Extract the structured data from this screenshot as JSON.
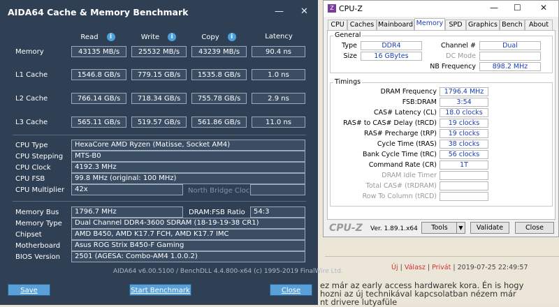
{
  "forum": {
    "meta_reply": "Új",
    "meta_quote": "Válasz",
    "meta_private": "Privát",
    "meta_date": "2019-07-25 22:49:57",
    "text_line1": "ez már az early access hardwarek kora. Én is hogy",
    "text_line2": "hozni az új technikával kapcsolatban nézem már",
    "text_line3": "nt drivere lutyafüle"
  },
  "aida": {
    "title": "AIDA64 Cache & Memory Benchmark",
    "minimize": "—",
    "close": "✕",
    "columns": {
      "read": "Read",
      "write": "Write",
      "copy": "Copy",
      "latency": "Latency"
    },
    "rows": [
      {
        "label": "Memory",
        "read": "43135 MB/s",
        "write": "25532 MB/s",
        "copy": "43239 MB/s",
        "latency": "90.4 ns"
      },
      {
        "label": "L1 Cache",
        "read": "1546.8 GB/s",
        "write": "779.15 GB/s",
        "copy": "1535.8 GB/s",
        "latency": "1.0 ns"
      },
      {
        "label": "L2 Cache",
        "read": "766.14 GB/s",
        "write": "718.34 GB/s",
        "copy": "755.78 GB/s",
        "latency": "2.9 ns"
      },
      {
        "label": "L3 Cache",
        "read": "565.11 GB/s",
        "write": "519.57 GB/s",
        "copy": "561.86 GB/s",
        "latency": "11.0 ns"
      }
    ],
    "cpu": {
      "type_label": "CPU Type",
      "type": "HexaCore AMD Ryzen  (Matisse, Socket AM4)",
      "stepping_label": "CPU Stepping",
      "stepping": "MTS-B0",
      "clock_label": "CPU Clock",
      "clock": "4192.3 MHz",
      "fsb_label": "CPU FSB",
      "fsb": "99.8 MHz  (original: 100 MHz)",
      "mult_label": "CPU Multiplier",
      "mult": "42x",
      "nb_label": "North Bridge Clock",
      "nb": ""
    },
    "mem": {
      "bus_label": "Memory Bus",
      "bus": "1796.7 MHz",
      "ratio_label": "DRAM:FSB Ratio",
      "ratio": "54:3",
      "type_label": "Memory Type",
      "type": "Dual Channel DDR4-3600 SDRAM  (18-19-19-38 CR1)",
      "chipset_label": "Chipset",
      "chipset": "AMD B450, AMD K17.7 FCH, AMD K17.7 IMC",
      "mb_label": "Motherboard",
      "mb": "Asus ROG Strix B450-F Gaming",
      "bios_label": "BIOS Version",
      "bios": "2501  (AGESA: Combo-AM4 1.0.0.2)"
    },
    "footer": "AIDA64 v6.00.5100 / BenchDLL 4.4.800-x64  (c) 1995-2019 FinalWire Ltd.",
    "buttons": {
      "save": "Save",
      "start": "Start Benchmark",
      "close": "Close"
    }
  },
  "cpuz": {
    "title": "CPU-Z",
    "icon": "Z",
    "win_min": "—",
    "win_max": "☐",
    "win_close": "✕",
    "tabs": [
      "CPU",
      "Caches",
      "Mainboard",
      "Memory",
      "SPD",
      "Graphics",
      "Bench",
      "About"
    ],
    "general": {
      "label": "General",
      "type_label": "Type",
      "type": "DDR4",
      "channel_label": "Channel #",
      "channel": "Dual",
      "size_label": "Size",
      "size": "16 GBytes",
      "dc_label": "DC Mode",
      "dc": "",
      "nb_label": "NB Frequency",
      "nb": "898.2 MHz"
    },
    "timings": {
      "label": "Timings",
      "rows": [
        {
          "label": "DRAM Frequency",
          "value": "1796.4 MHz",
          "dim": false
        },
        {
          "label": "FSB:DRAM",
          "value": "3:54",
          "dim": false
        },
        {
          "label": "CAS# Latency (CL)",
          "value": "18.0 clocks",
          "dim": false
        },
        {
          "label": "RAS# to CAS# Delay (tRCD)",
          "value": "19 clocks",
          "dim": false
        },
        {
          "label": "RAS# Precharge (tRP)",
          "value": "19 clocks",
          "dim": false
        },
        {
          "label": "Cycle Time (tRAS)",
          "value": "38 clocks",
          "dim": false
        },
        {
          "label": "Bank Cycle Time (tRC)",
          "value": "56 clocks",
          "dim": false
        },
        {
          "label": "Command Rate (CR)",
          "value": "1T",
          "dim": false
        },
        {
          "label": "DRAM Idle Timer",
          "value": "",
          "dim": true
        },
        {
          "label": "Total CAS# (tRDRAM)",
          "value": "",
          "dim": true
        },
        {
          "label": "Row To Column (tRCD)",
          "value": "",
          "dim": true
        }
      ]
    },
    "logo": "CPU-Z",
    "version": "Ver. 1.89.1.x64",
    "tools": "Tools",
    "tools_arrow": "▼",
    "validate": "Validate",
    "close": "Close"
  }
}
